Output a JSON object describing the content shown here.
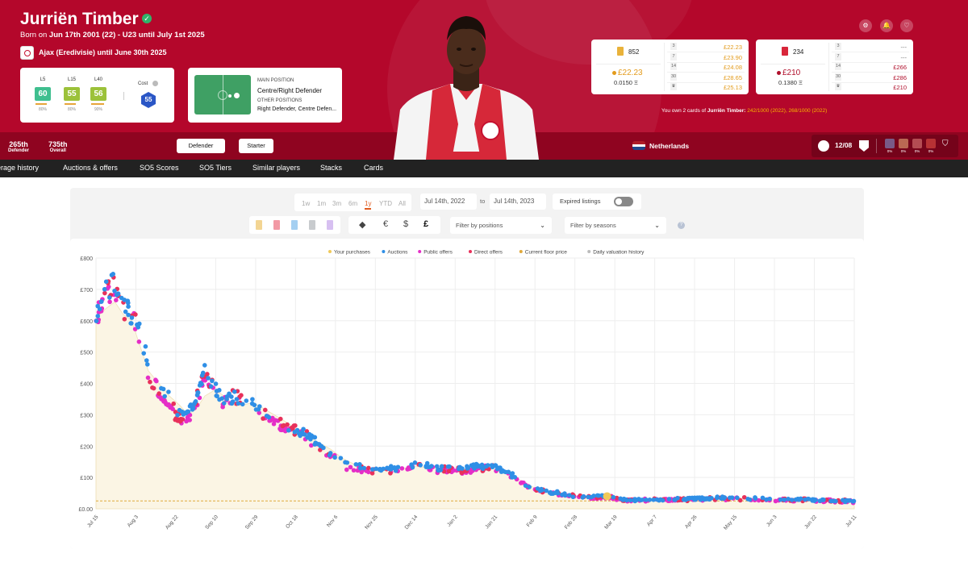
{
  "player": {
    "name": "Jurriën Timber",
    "born_prefix": "Born on",
    "born_detail": "Jun 17th 2001 (22) - U23 until July 1st 2025",
    "club": "Ajax (Eredivisie) until June 30th 2025"
  },
  "scores": {
    "items": [
      {
        "label": "L5",
        "value": "60",
        "color": "#3fbf8f",
        "bar_fraction": 0.8,
        "pct": "80%"
      },
      {
        "label": "L15",
        "value": "55",
        "color": "#9cc23a",
        "bar_fraction": 0.8,
        "pct": "80%"
      },
      {
        "label": "L40",
        "value": "56",
        "color": "#9cc23a",
        "bar_fraction": 0.9,
        "pct": "90%"
      }
    ],
    "cost_label": "Cost",
    "cost_value": "55"
  },
  "position": {
    "main_label": "MAIN POSITION",
    "main_value": "Centre/Right Defender",
    "other_label": "OTHER POSITIONS",
    "other_value": "Right Defender, Centre Defen..."
  },
  "market": [
    {
      "chip_color": "#e9b23a",
      "count": "852",
      "price": "£22.23",
      "price_color": "#e39b1c",
      "eth": "0.0150 Ξ",
      "tiers": [
        {
          "tier": "3",
          "value": "£22.23"
        },
        {
          "tier": "7",
          "value": "£23.90"
        },
        {
          "tier": "14",
          "value": "£24.08"
        },
        {
          "tier": "30",
          "value": "£28.65"
        },
        {
          "tier": "♛",
          "value": "£25.13"
        }
      ],
      "value_color": "#e39b1c"
    },
    {
      "chip_color": "#d8263a",
      "count": "234",
      "price": "£210",
      "price_color": "#b0102c",
      "eth": "0.1380 Ξ",
      "tiers": [
        {
          "tier": "3",
          "value": "---"
        },
        {
          "tier": "7",
          "value": "---"
        },
        {
          "tier": "14",
          "value": "£266"
        },
        {
          "tier": "30",
          "value": "£286"
        },
        {
          "tier": "♛",
          "value": "£210"
        }
      ],
      "value_color": "#b0102c"
    }
  ],
  "ownership": {
    "prefix": "You own 2 cards of",
    "name": "Jurriën Timber:",
    "detail": "242/1000 (2022), 268/1000 (2022)"
  },
  "rank": {
    "defender_value": "265th",
    "defender_label": "Defender",
    "overall_value": "735th",
    "overall_label": "Overall"
  },
  "tags": [
    "Defender",
    "Starter"
  ],
  "country": "Netherlands",
  "fixture": {
    "date": "12/08",
    "form": [
      "0%",
      "0%",
      "0%",
      "0%"
    ]
  },
  "tabs": [
    "erage history",
    "Auctions & offers",
    "SO5 Scores",
    "SO5 Tiers",
    "Similar players",
    "Stacks",
    "Cards"
  ],
  "filters": {
    "ranges": [
      "1w",
      "1m",
      "3m",
      "6m",
      "1y",
      "YTD",
      "All"
    ],
    "active_range": "1y",
    "date_from": "Jul 14th, 2022",
    "to": "to",
    "date_to": "Jul 14th, 2023",
    "expired_label": "Expired listings",
    "currencies": [
      "◆",
      "€",
      "$",
      "£"
    ],
    "active_currency": "£",
    "positions_placeholder": "Filter by positions",
    "seasons_placeholder": "Filter by seasons"
  },
  "colors": {
    "hero": "#b4072b",
    "auction": "#2f8fe6",
    "public": "#e52ec7",
    "direct": "#e8315b",
    "purchase": "#f0c95a",
    "floor": "#e0a93b"
  },
  "chart_data": {
    "type": "scatter",
    "legend": [
      "Your purchases",
      "Auctions",
      "Public offers",
      "Direct offers",
      "Current floor price",
      "Daily valuation history"
    ],
    "legend_position": "top-center",
    "y_ticks": [
      "£800",
      "£700",
      "£600",
      "£500",
      "£400",
      "£300",
      "£200",
      "£100",
      "£0.00"
    ],
    "ylim": [
      0,
      800
    ],
    "x_ticks": [
      "Jul 15",
      "Aug 3",
      "Aug 22",
      "Sep 10",
      "Sep 29",
      "Oct 18",
      "Nov 6",
      "Nov 25",
      "Dec 14",
      "Jan 2",
      "Jan 21",
      "Feb 9",
      "Feb 28",
      "Mar 19",
      "Apr 7",
      "Apr 26",
      "May 15",
      "Jun 3",
      "Jun 22",
      "Jul 11"
    ],
    "x_range_days": [
      0,
      362
    ],
    "floor_price": 25,
    "valuation_history": [
      [
        0,
        610
      ],
      [
        5,
        640
      ],
      [
        9,
        660
      ],
      [
        13,
        620
      ],
      [
        17,
        600
      ],
      [
        19,
        560
      ],
      [
        22,
        500
      ],
      [
        25,
        440
      ],
      [
        30,
        400
      ],
      [
        35,
        360
      ],
      [
        40,
        330
      ],
      [
        44,
        300
      ],
      [
        48,
        320
      ],
      [
        52,
        360
      ],
      [
        57,
        380
      ],
      [
        61,
        360
      ],
      [
        66,
        330
      ],
      [
        70,
        330
      ],
      [
        75,
        340
      ],
      [
        80,
        320
      ],
      [
        85,
        300
      ],
      [
        90,
        280
      ],
      [
        97,
        250
      ],
      [
        104,
        220
      ],
      [
        112,
        190
      ],
      [
        118,
        160
      ],
      [
        124,
        140
      ],
      [
        133,
        125
      ],
      [
        143,
        125
      ],
      [
        152,
        135
      ],
      [
        162,
        130
      ],
      [
        171,
        125
      ],
      [
        181,
        130
      ],
      [
        190,
        130
      ],
      [
        197,
        115
      ],
      [
        204,
        85
      ],
      [
        210,
        65
      ],
      [
        220,
        50
      ],
      [
        230,
        40
      ],
      [
        238,
        38
      ],
      [
        245,
        40
      ],
      [
        252,
        28
      ],
      [
        262,
        30
      ],
      [
        272,
        30
      ],
      [
        285,
        30
      ],
      [
        300,
        35
      ],
      [
        315,
        32
      ],
      [
        330,
        30
      ],
      [
        345,
        25
      ],
      [
        358,
        25
      ],
      [
        362,
        25
      ]
    ],
    "purchases": [
      [
        244,
        40
      ]
    ],
    "trend_auctions": [
      [
        0,
        605
      ],
      [
        5,
        700
      ],
      [
        9,
        720
      ],
      [
        13,
        660
      ],
      [
        17,
        610
      ],
      [
        19,
        600
      ],
      [
        22,
        540
      ],
      [
        25,
        460
      ],
      [
        30,
        400
      ],
      [
        35,
        350
      ],
      [
        40,
        300
      ],
      [
        44,
        300
      ],
      [
        48,
        360
      ],
      [
        52,
        450
      ],
      [
        57,
        380
      ],
      [
        61,
        350
      ],
      [
        66,
        360
      ],
      [
        70,
        340
      ],
      [
        75,
        330
      ],
      [
        80,
        310
      ],
      [
        85,
        290
      ],
      [
        90,
        270
      ],
      [
        97,
        250
      ],
      [
        104,
        220
      ],
      [
        112,
        180
      ],
      [
        118,
        150
      ],
      [
        124,
        135
      ],
      [
        133,
        125
      ],
      [
        143,
        130
      ],
      [
        152,
        140
      ],
      [
        162,
        132
      ],
      [
        171,
        128
      ],
      [
        181,
        135
      ],
      [
        190,
        135
      ],
      [
        197,
        115
      ],
      [
        204,
        82
      ],
      [
        210,
        63
      ],
      [
        220,
        50
      ],
      [
        230,
        42
      ],
      [
        238,
        38
      ],
      [
        245,
        40
      ],
      [
        252,
        28
      ],
      [
        262,
        30
      ],
      [
        272,
        30
      ],
      [
        285,
        32
      ],
      [
        300,
        35
      ],
      [
        315,
        33
      ],
      [
        330,
        30
      ],
      [
        345,
        28
      ],
      [
        358,
        25
      ],
      [
        362,
        25
      ]
    ],
    "trend_public": [
      [
        0,
        600
      ],
      [
        5,
        680
      ],
      [
        9,
        700
      ],
      [
        13,
        640
      ],
      [
        17,
        600
      ],
      [
        19,
        580
      ],
      [
        22,
        520
      ],
      [
        25,
        420
      ],
      [
        30,
        380
      ],
      [
        35,
        320
      ],
      [
        40,
        280
      ],
      [
        44,
        290
      ],
      [
        48,
        340
      ],
      [
        52,
        430
      ],
      [
        57,
        360
      ],
      [
        61,
        340
      ],
      [
        66,
        370
      ],
      [
        70,
        350
      ],
      [
        75,
        320
      ],
      [
        80,
        300
      ],
      [
        85,
        280
      ],
      [
        90,
        260
      ],
      [
        97,
        240
      ],
      [
        104,
        210
      ],
      [
        112,
        170
      ],
      [
        118,
        140
      ],
      [
        124,
        125
      ],
      [
        133,
        118
      ],
      [
        143,
        122
      ],
      [
        152,
        130
      ],
      [
        162,
        125
      ],
      [
        171,
        120
      ],
      [
        181,
        125
      ],
      [
        190,
        130
      ],
      [
        197,
        110
      ],
      [
        204,
        80
      ],
      [
        210,
        60
      ],
      [
        220,
        48
      ],
      [
        230,
        40
      ],
      [
        238,
        35
      ],
      [
        245,
        38
      ],
      [
        252,
        26
      ],
      [
        262,
        28
      ],
      [
        272,
        28
      ],
      [
        285,
        30
      ],
      [
        300,
        33
      ],
      [
        315,
        31
      ],
      [
        330,
        28
      ],
      [
        345,
        26
      ],
      [
        358,
        24
      ],
      [
        362,
        24
      ]
    ],
    "trend_direct": [
      [
        0,
        615
      ],
      [
        5,
        690
      ],
      [
        9,
        710
      ],
      [
        13,
        650
      ],
      [
        17,
        605
      ],
      [
        19,
        590
      ],
      [
        22,
        510
      ],
      [
        25,
        430
      ],
      [
        30,
        390
      ],
      [
        35,
        330
      ],
      [
        40,
        290
      ],
      [
        44,
        295
      ],
      [
        48,
        350
      ],
      [
        52,
        440
      ],
      [
        57,
        370
      ],
      [
        61,
        345
      ],
      [
        66,
        365
      ],
      [
        70,
        345
      ],
      [
        75,
        325
      ],
      [
        80,
        305
      ],
      [
        85,
        285
      ],
      [
        90,
        265
      ],
      [
        97,
        245
      ],
      [
        104,
        215
      ],
      [
        112,
        175
      ],
      [
        118,
        145
      ],
      [
        124,
        130
      ],
      [
        133,
        120
      ],
      [
        143,
        126
      ],
      [
        152,
        135
      ],
      [
        162,
        128
      ],
      [
        171,
        124
      ],
      [
        181,
        130
      ],
      [
        190,
        132
      ],
      [
        197,
        112
      ],
      [
        204,
        81
      ],
      [
        210,
        62
      ],
      [
        220,
        49
      ],
      [
        230,
        41
      ],
      [
        238,
        36
      ],
      [
        245,
        39
      ],
      [
        252,
        27
      ],
      [
        262,
        29
      ],
      [
        272,
        29
      ],
      [
        285,
        31
      ],
      [
        300,
        34
      ],
      [
        315,
        32
      ],
      [
        330,
        29
      ],
      [
        345,
        27
      ],
      [
        358,
        25
      ],
      [
        362,
        25
      ]
    ]
  }
}
